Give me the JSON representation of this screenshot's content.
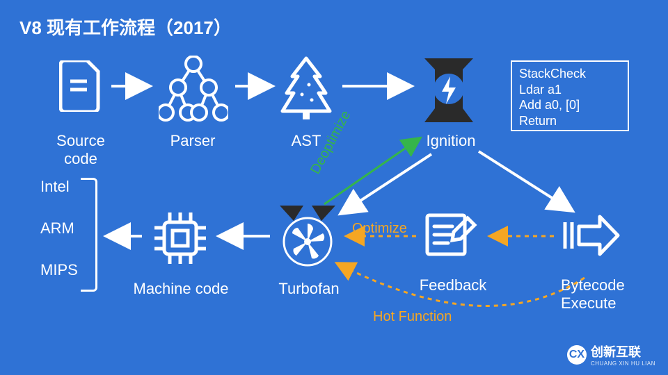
{
  "title": "V8 现有工作流程（2017）",
  "nodes": {
    "source": {
      "label": "Source code"
    },
    "parser": {
      "label": "Parser"
    },
    "ast": {
      "label": "AST"
    },
    "ignition": {
      "label": "Ignition"
    },
    "machine": {
      "label": "Machine code"
    },
    "turbofan": {
      "label": "Turbofan"
    },
    "feedback": {
      "label": "Feedback"
    },
    "bytecode": {
      "label": "Bytecode\nExecute"
    }
  },
  "arch": {
    "intel": "Intel",
    "arm": "ARM",
    "mips": "MIPS"
  },
  "bytecode_sample": "StackCheck\nLdar a1\nAdd a0, [0]\nReturn",
  "annotations": {
    "deoptimize": "Deoptimize",
    "optimize": "Optimize",
    "hotfn": "Hot Function"
  },
  "colors": {
    "bg": "#2F72D5",
    "optimize": "#F5A623",
    "deoptimize": "#35B54A",
    "fg": "#FFFFFF"
  },
  "footer": {
    "brand_zh": "创新互联",
    "brand_en": "CHUANG XIN HU LIAN",
    "mark": "CX"
  }
}
